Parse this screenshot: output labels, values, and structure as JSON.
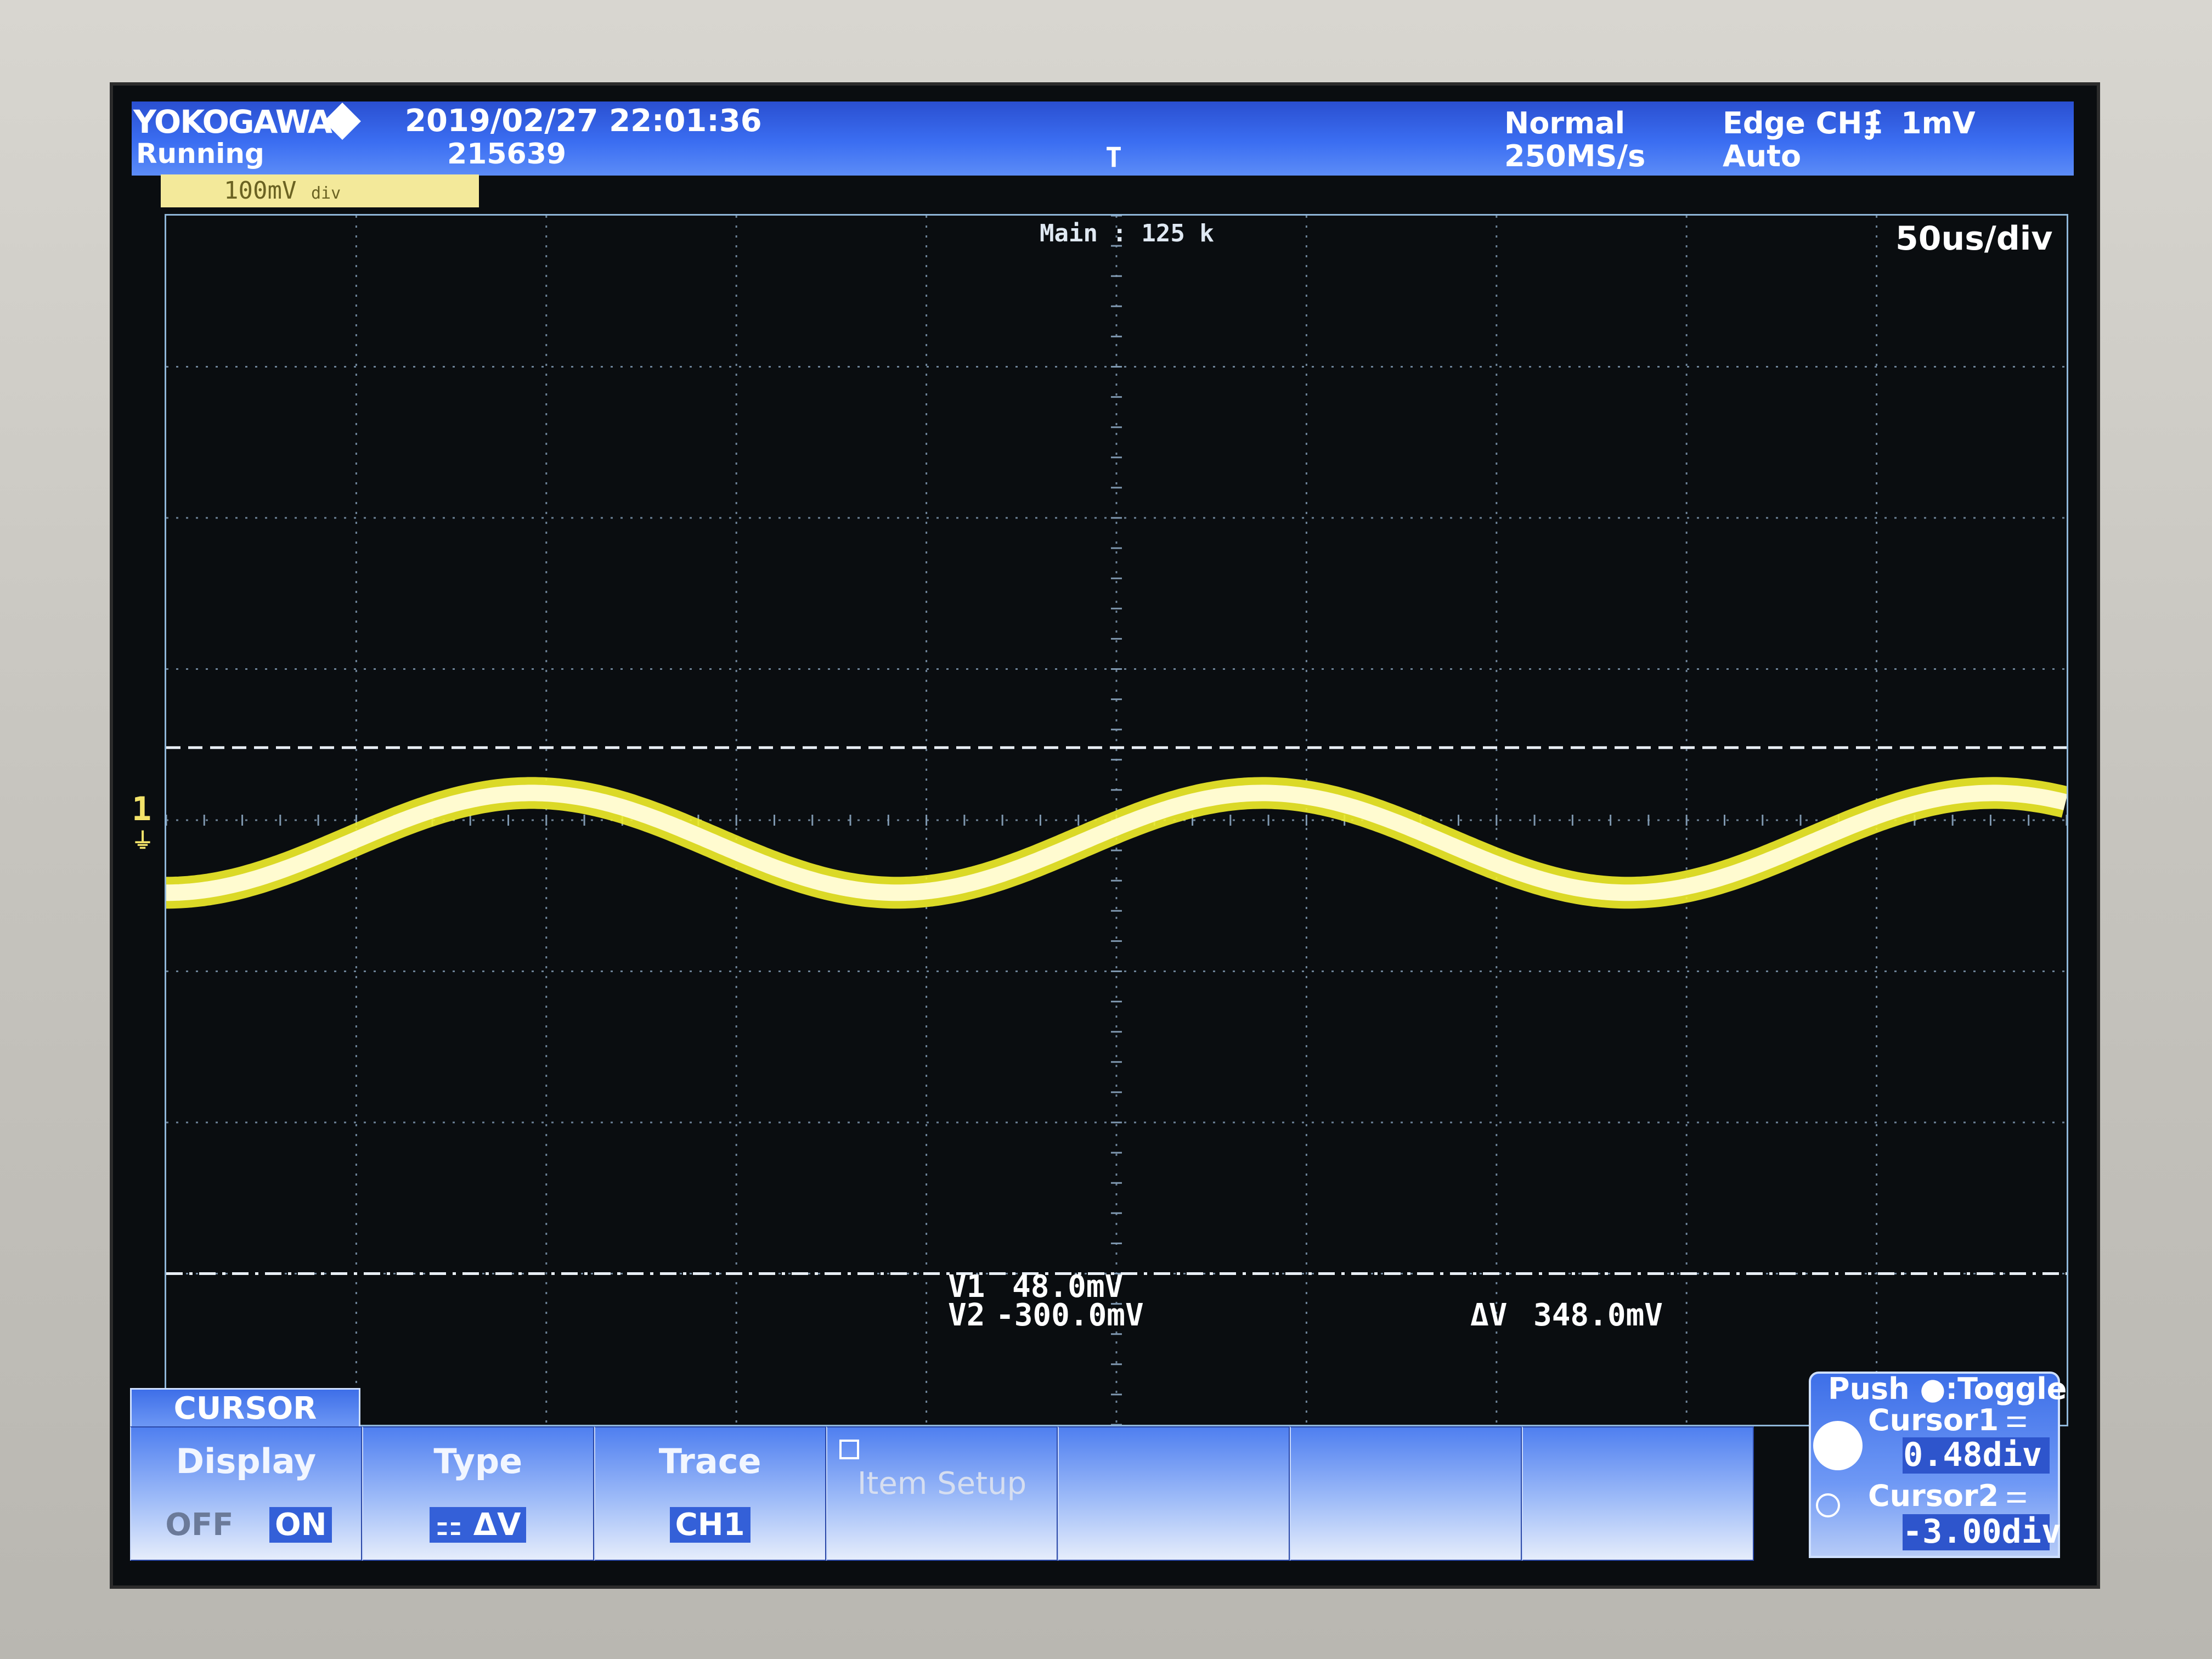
{
  "header": {
    "brand": "YOKOGAWA",
    "status": "Running",
    "datetime": "2019/02/27 22:01:36",
    "acq_count": "215639",
    "trigger_mode": "Normal",
    "sample_rate": "250MS/s",
    "trigger_source": "Edge CH1",
    "trigger_level": "1mV",
    "trigger_auto": "Auto",
    "trigger_position_marker": "T"
  },
  "channel": {
    "scale": "100mV",
    "unit_suffix": "div"
  },
  "display": {
    "record_length": "Main : 125 k",
    "timebase": "50us/div",
    "ground_marker": "1"
  },
  "measurements": {
    "v1_label": "V1",
    "v1_value": "48.0mV",
    "v2_label": "V2",
    "v2_value": "-300.0mV",
    "dv_label": "ΔV",
    "dv_value": "348.0mV"
  },
  "menu": {
    "tab": "CURSOR",
    "display": {
      "title": "Display",
      "off": "OFF",
      "on": "ON"
    },
    "type": {
      "title": "Type",
      "value": "ΔV"
    },
    "trace": {
      "title": "Trace",
      "value": "CH1"
    },
    "item_setup": {
      "title": "Item Setup"
    }
  },
  "jog": {
    "hint": "Push ●:Toggle",
    "cursor1_label": "Cursor1",
    "cursor1_value": "0.48div",
    "cursor2_label": "Cursor2",
    "cursor2_value": "-3.00div"
  },
  "colors": {
    "trace": "#f2f02a",
    "grid": "#7f98b0",
    "cursor": "#e8eef5",
    "menu_blue": "#3b6ef2"
  },
  "waveform": {
    "type": "sine",
    "channel": "CH1",
    "periods_on_screen": 2.6,
    "center_div": -0.15,
    "amplitude_div": 0.33,
    "cursor1_div": 0.48,
    "cursor2_div": -3.0
  }
}
